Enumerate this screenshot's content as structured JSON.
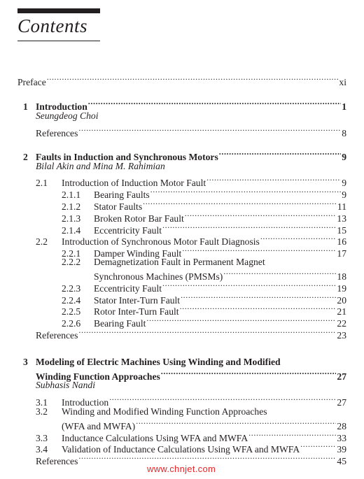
{
  "heading": "Contents",
  "preface": {
    "label": "Preface",
    "page": "xi"
  },
  "chapters": [
    {
      "number": "1",
      "title": "Introduction",
      "page": "1",
      "author": "Seungdeog Choi",
      "references": {
        "label": "References",
        "page": "8"
      }
    },
    {
      "number": "2",
      "title": "Faults in Induction and Synchronous Motors",
      "page": "9",
      "author": "Bilal Akin and Mina M. Rahimian",
      "sections": [
        {
          "number": "2.1",
          "title": "Introduction of Induction Motor Fault",
          "page": "9",
          "subsections": [
            {
              "number": "2.1.1",
              "title": "Bearing Faults",
              "page": "9"
            },
            {
              "number": "2.1.2",
              "title": "Stator Faults",
              "page": "11"
            },
            {
              "number": "2.1.3",
              "title": "Broken Rotor Bar Fault",
              "page": "13"
            },
            {
              "number": "2.1.4",
              "title": "Eccentricity Fault",
              "page": "15"
            }
          ]
        },
        {
          "number": "2.2",
          "title": "Introduction of Synchronous Motor Fault Diagnosis",
          "page": "16",
          "subsections": [
            {
              "number": "2.2.1",
              "title": "Damper Winding Fault",
              "page": "17"
            },
            {
              "number": "2.2.2",
              "title_line1": "Demagnetization Fault in Permanent Magnet",
              "title_line2": "Synchronous Machines (PMSMs)",
              "page": "18"
            },
            {
              "number": "2.2.3",
              "title": "Eccentricity Fault",
              "page": "19"
            },
            {
              "number": "2.2.4",
              "title": "Stator Inter-Turn Fault",
              "page": "20"
            },
            {
              "number": "2.2.5",
              "title": "Rotor Inter-Turn Fault",
              "page": "21"
            },
            {
              "number": "2.2.6",
              "title": "Bearing Fault",
              "page": "22"
            }
          ]
        }
      ],
      "references": {
        "label": "References",
        "page": "23"
      }
    },
    {
      "number": "3",
      "title_line1": "Modeling of Electric Machines Using Winding and Modified",
      "title_line2": "Winding Function Approaches",
      "page": "27",
      "author": "Subhasis Nandi",
      "sections": [
        {
          "number": "3.1",
          "title": "Introduction",
          "page": "27"
        },
        {
          "number": "3.2",
          "title_line1": "Winding and Modified Winding Function Approaches",
          "title_line2": "(WFA and MWFA)",
          "page": "28"
        },
        {
          "number": "3.3",
          "title": "Inductance Calculations Using WFA and MWFA",
          "page": "33"
        },
        {
          "number": "3.4",
          "title": "Validation of Inductance Calculations Using WFA and MWFA",
          "page": "39"
        }
      ],
      "references": {
        "label": "References",
        "page": "45"
      }
    }
  ],
  "watermark": "www.chnjet.com"
}
